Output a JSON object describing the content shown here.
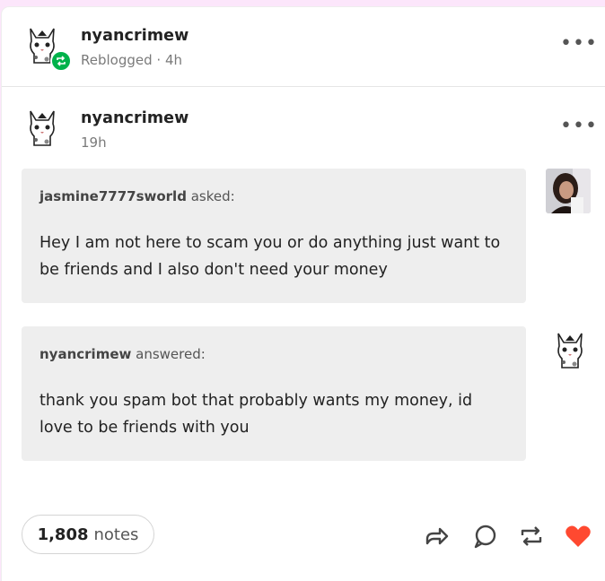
{
  "reblog_header": {
    "username": "nyancrimew",
    "meta": "Reblogged · 4h",
    "more_label": "•••"
  },
  "post_header": {
    "username": "nyancrimew",
    "time": "19h",
    "more_label": "•••"
  },
  "ask": {
    "asker": "jasmine7777sworld",
    "asked_label": "asked:",
    "text": "Hey I am not here to scam you  or do anything just want to be friends and I also don't need your money"
  },
  "answer": {
    "answerer": "nyancrimew",
    "answered_label": "answered:",
    "text": "thank you spam bot that probably wants my money, id love to be friends with you"
  },
  "footer": {
    "notes_count": "1,808",
    "notes_label": "notes"
  },
  "colors": {
    "reblog_green": "#00b24b",
    "heart_red": "#ff4930",
    "bubble_bg": "#eeeeee"
  },
  "icons": [
    "reblog-icon",
    "share-icon",
    "reply-icon",
    "reblog-action-icon",
    "heart-icon",
    "more-icon",
    "cat-avatar-icon"
  ]
}
